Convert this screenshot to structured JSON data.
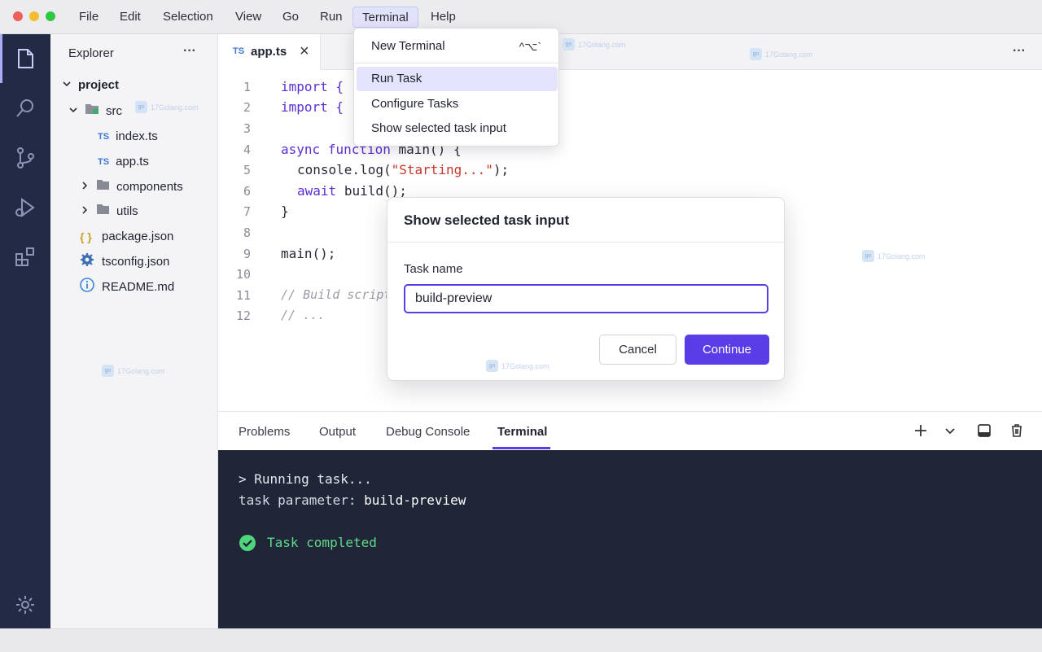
{
  "menubar": {
    "items": [
      "File",
      "Edit",
      "Selection",
      "View",
      "Go",
      "Run",
      "Terminal",
      "Help"
    ],
    "active": "Terminal"
  },
  "activity_bar": {
    "icons": [
      "files-icon",
      "search-icon",
      "source-control-icon",
      "run-debug-icon",
      "extensions-icon",
      "settings-gear-icon"
    ],
    "accent_color": "#a9adf7"
  },
  "explorer": {
    "title": "Explorer",
    "more": "···",
    "tree": {
      "project": "project",
      "src": "src",
      "index_ts": "index.ts",
      "app_ts": "app.ts",
      "components": "components",
      "utils": "utils",
      "package_json": "package.json",
      "tsconfig_json": "tsconfig.json",
      "readme": "README.md",
      "ts_badge": "TS",
      "json_badge": "{ }"
    }
  },
  "editor": {
    "tab": {
      "badge": "TS",
      "label": "app.ts",
      "close": "×"
    },
    "more": "···",
    "line_numbers": [
      "1",
      "2",
      "3",
      "4",
      "5",
      "6",
      "7",
      "8",
      "9",
      "10",
      "11",
      "12"
    ],
    "code": {
      "l1": "import {",
      "l2": "import {",
      "l4_async": "async",
      "l4_function": "function",
      "l4_rest": "main() {",
      "l5_pre": "console.log(",
      "l5_str": "\"Starting...\"",
      "l5_post": ");",
      "l6_await": "await",
      "l6_rest": "build();",
      "l7": "}",
      "l9": "main();",
      "l11": "// Build script e",
      "l12": "// ..."
    }
  },
  "terminal_menu": {
    "items": [
      "New Terminal",
      "Run Task",
      "Configure Tasks",
      "Show selected task input"
    ],
    "shortcut": "^⌥`",
    "highlighted": "Run Task"
  },
  "dialog": {
    "title": "Show selected task input",
    "field_label": "Task name",
    "field_value": "build-preview",
    "cancel": "Cancel",
    "continue": "Continue",
    "primary_color": "#5b3de8"
  },
  "panel": {
    "tabs": [
      "Problems",
      "Output",
      "Debug Console",
      "Terminal"
    ],
    "active_tab": "Terminal",
    "actions": [
      "plus-icon",
      "chevron-down-icon",
      "maximize-panel-icon",
      "trash-icon"
    ],
    "terminal": {
      "prompt": "> Running task...",
      "param_label": "task parameter:",
      "param_value": "build-preview",
      "completed": "Task completed",
      "success_color": "#4fd57b"
    }
  },
  "watermark": "17Golang.com"
}
